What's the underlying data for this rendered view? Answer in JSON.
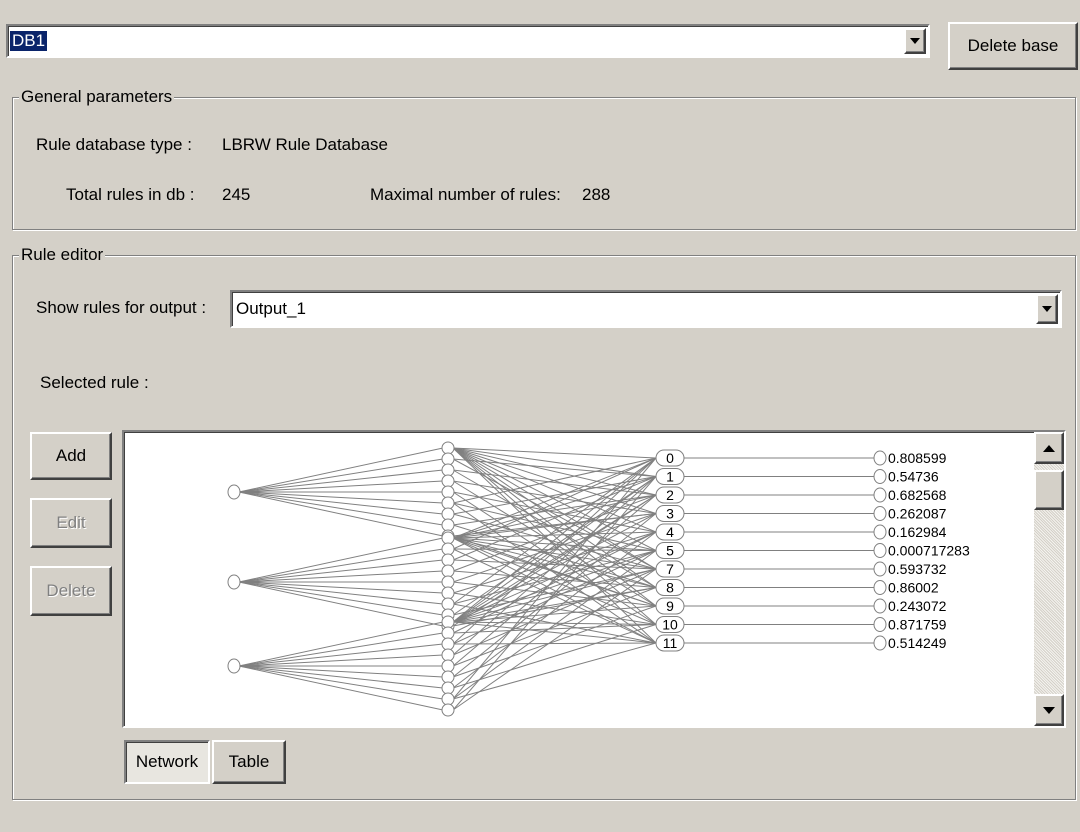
{
  "header": {
    "db_select_value": "DB1",
    "delete_base_label": "Delete base"
  },
  "general": {
    "title": "General parameters",
    "type_label": "Rule database type :",
    "type_value": "LBRW Rule Database",
    "total_label": "Total rules in db :",
    "total_value": "245",
    "max_label": "Maximal number of rules:",
    "max_value": "288"
  },
  "editor": {
    "title": "Rule editor",
    "show_for_label": "Show rules for output :",
    "output_value": "Output_1",
    "selected_label": "Selected rule :",
    "add_label": "Add",
    "edit_label": "Edit",
    "delete_label": "Delete",
    "tab_network": "Network",
    "tab_table": "Table"
  },
  "network": {
    "input_nodes": 3,
    "hidden_per_input": 9,
    "rule_ids": [
      "0",
      "1",
      "2",
      "3",
      "4",
      "5",
      "7",
      "8",
      "9",
      "10",
      "11"
    ],
    "outputs": [
      "0.808599",
      "0.54736",
      "0.682568",
      "0.262087",
      "0.162984",
      "0.000717283",
      "0.593732",
      "0.86002",
      "0.243072",
      "0.871759",
      "0.514249"
    ],
    "line_color": "#808080"
  }
}
